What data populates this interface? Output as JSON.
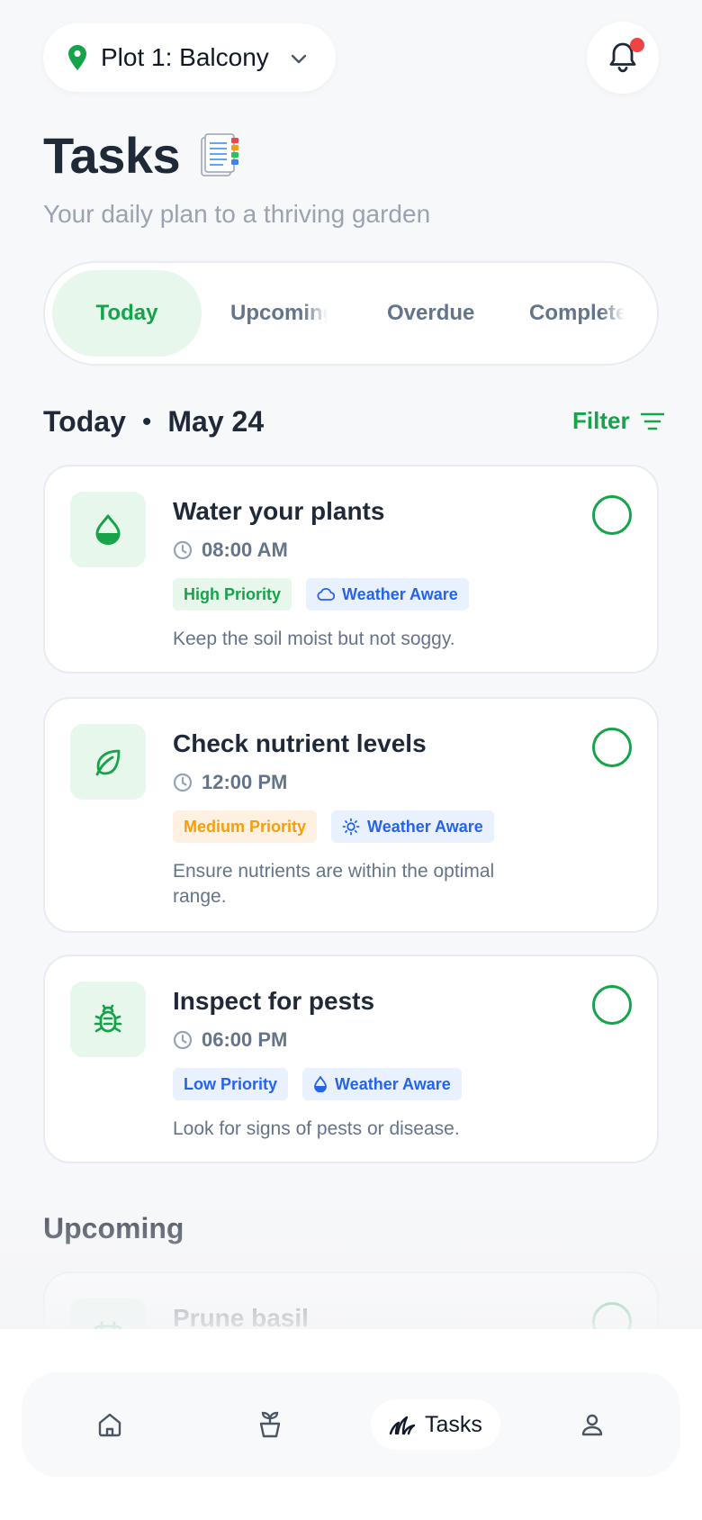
{
  "header": {
    "plot_label": "Plot 1: Balcony",
    "pin_icon": "map-pin-icon",
    "chevron_icon": "chevron-down-icon",
    "bell_icon": "bell-icon",
    "has_notification": true
  },
  "page": {
    "title": "Tasks",
    "title_emoji": "📑",
    "subtitle": "Your daily plan to a thriving garden"
  },
  "tabs": [
    {
      "label": "Today",
      "active": true
    },
    {
      "label": "Upcoming",
      "active": false
    },
    {
      "label": "Overdue",
      "active": false
    },
    {
      "label": "Completed",
      "active": false
    }
  ],
  "today_section": {
    "label": "Today",
    "separator": "•",
    "date": "May 24",
    "filter_label": "Filter",
    "filter_icon": "filter-lines-icon"
  },
  "tasks": [
    {
      "name": "Water your plants",
      "icon": "water-drop-icon",
      "time": "08:00 AM",
      "priority": "High Priority",
      "weather": "Weather Aware",
      "weather_icon": "cloud-icon",
      "note": "Keep the soil moist but not soggy."
    },
    {
      "name": "Check nutrient levels",
      "icon": "leaf-icon",
      "time": "12:00 PM",
      "priority": "Medium Priority",
      "weather": "Weather Aware",
      "weather_icon": "sun-icon",
      "note": "Ensure nutrients are within the optimal range."
    },
    {
      "name": "Inspect for pests",
      "icon": "bug-icon",
      "time": "06:00 PM",
      "priority": "Low Priority",
      "weather": "Weather Aware",
      "weather_icon": "droplet-icon",
      "note": "Look for signs of pests or disease."
    }
  ],
  "upcoming_section": {
    "label": "Upcoming",
    "first_task": {
      "name": "Prune basil",
      "icon": "calendar-icon"
    }
  },
  "bottom_nav": [
    {
      "icon": "home-icon",
      "label": ""
    },
    {
      "icon": "plant-pot-icon",
      "label": ""
    },
    {
      "icon": "grass-icon",
      "label": "Tasks",
      "active": true
    },
    {
      "icon": "user-icon",
      "label": ""
    }
  ],
  "colors": {
    "accent": "#16a34a",
    "accent_bg": "#e8f7ec",
    "blue": "#2563eb",
    "orange": "#f59e0b",
    "notification": "#ef4444"
  }
}
